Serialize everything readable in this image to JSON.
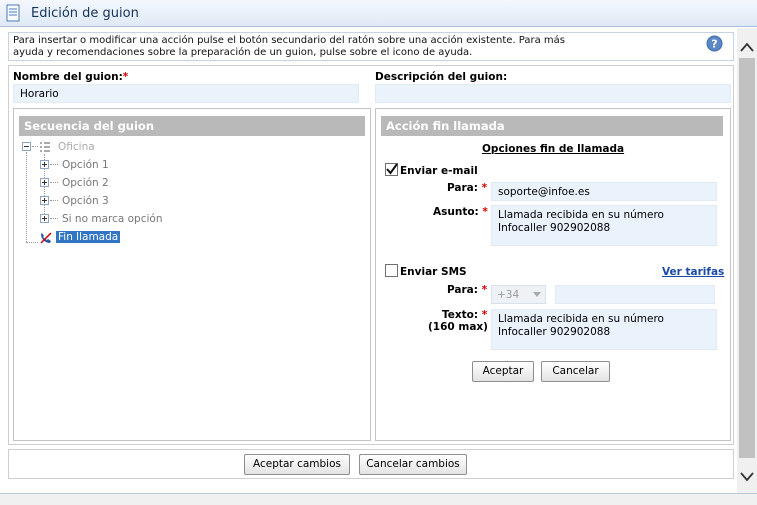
{
  "window": {
    "title": "Edición de guion"
  },
  "info": {
    "text_line1": "Para insertar o modificar una acción pulse el botón secundario del ratón sobre una acción existente. Para más",
    "text_line2": "ayuda y recomendaciones sobre la preparación de un guion, pulse sobre el icono de ayuda."
  },
  "form": {
    "name_label": "Nombre del guion:",
    "name_value": "Horario",
    "description_label": "Descripción del guion:",
    "description_value": ""
  },
  "sequence": {
    "title": "Secuencia del guion",
    "root": "Oficina",
    "options": [
      "Opción 1",
      "Opción 2",
      "Opción 3",
      "Si no marca opción"
    ],
    "end_call": "Fin llamada"
  },
  "end_action": {
    "title": "Acción fin llamada",
    "options_heading": "Opciones fin de llamada",
    "email": {
      "label": "Enviar e-mail",
      "checked": true,
      "to_label": "Para:",
      "to_value": "soporte@infoe.es",
      "subject_label": "Asunto:",
      "subject_value": "Llamada recibida en su número Infocaller 902902088"
    },
    "sms": {
      "label": "Enviar SMS",
      "checked": false,
      "rates_link": "Ver tarifas",
      "to_label": "Para:",
      "prefix": "+34",
      "phone_value": "",
      "text_label": "Texto:",
      "text_limit": "(160 max)",
      "text_value": "Llamada recibida en su número Infocaller 902902088"
    },
    "accept": "Aceptar",
    "cancel": "Cancelar"
  },
  "footer": {
    "accept_changes": "Aceptar cambios",
    "cancel_changes": "Cancelar cambios"
  },
  "colors": {
    "panel_header": "#b9b9b9",
    "selected": "#3275c3",
    "input_bg": "#eaf2fb",
    "required": "#cc0000"
  }
}
